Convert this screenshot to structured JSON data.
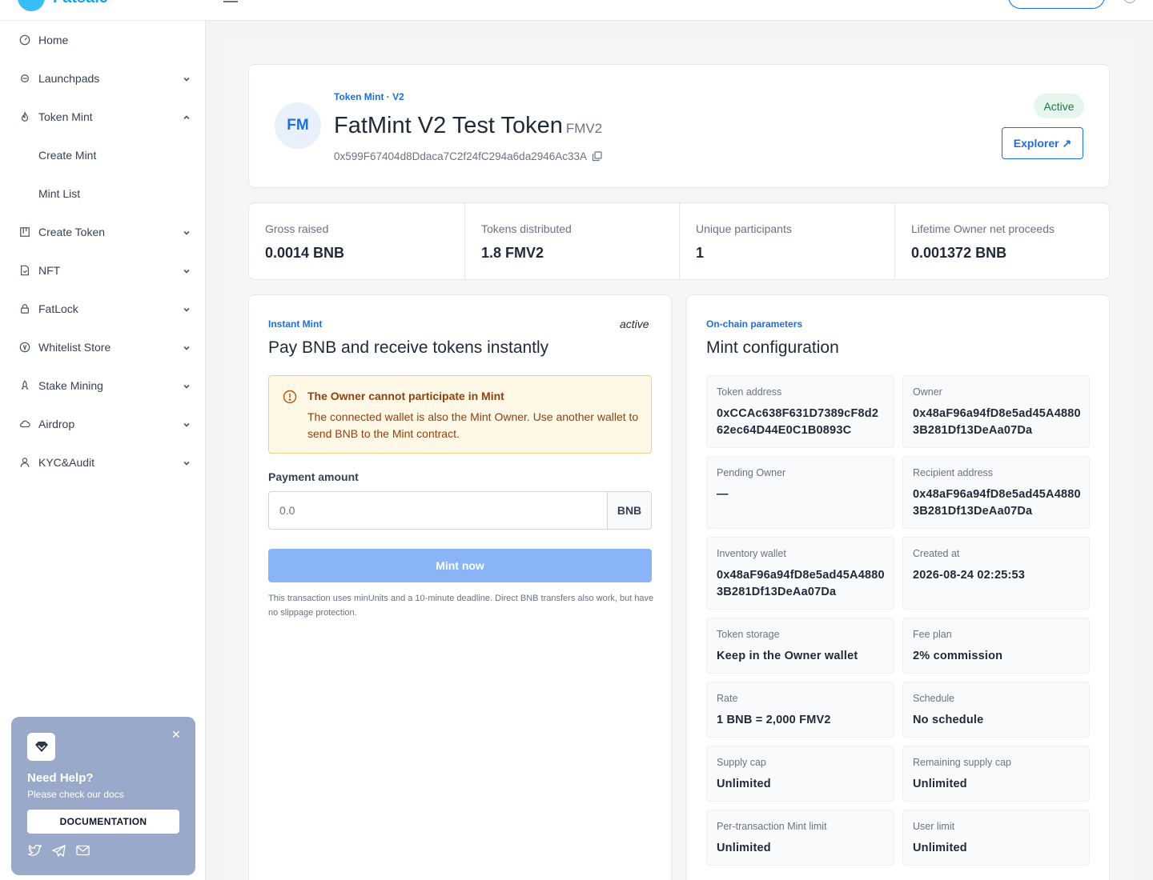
{
  "topbar": {
    "brand": "Fatsale"
  },
  "sidebar": {
    "items": [
      {
        "label": "Home",
        "icon": "gauge-icon",
        "expandable": false
      },
      {
        "label": "Launchpads",
        "icon": "rocket-icon",
        "expandable": true
      },
      {
        "label": "Token Mint",
        "icon": "flame-icon",
        "expandable": true,
        "expanded": true
      },
      {
        "label": "Create Mint",
        "sub": true
      },
      {
        "label": "Mint List",
        "sub": true
      },
      {
        "label": "Create Token",
        "icon": "grid-icon",
        "expandable": true
      },
      {
        "label": "NFT",
        "icon": "file-icon",
        "expandable": true
      },
      {
        "label": "FatLock",
        "icon": "lock-icon",
        "expandable": true
      },
      {
        "label": "Whitelist Store",
        "icon": "coin-icon",
        "expandable": true
      },
      {
        "label": "Stake Mining",
        "icon": "rocket-small-icon",
        "expandable": true
      },
      {
        "label": "Airdrop",
        "icon": "cloud-icon",
        "expandable": true
      },
      {
        "label": "KYC&Audit",
        "icon": "user-icon",
        "expandable": true
      }
    ],
    "help": {
      "title": "Need Help?",
      "subtitle": "Please check our docs",
      "button": "DOCUMENTATION"
    }
  },
  "header": {
    "eyebrow": "Token Mint · V2",
    "avatar": "FM",
    "name": "FatMint V2 Test Token",
    "symbol": "FMV2",
    "address": "0x599F67404d8Ddaca7C2f24fC294a6da2946Ac33A",
    "status": "Active",
    "explorer_label": "Explorer ↗"
  },
  "stats": [
    {
      "label": "Gross raised",
      "value": "0.0014 BNB"
    },
    {
      "label": "Tokens distributed",
      "value": "1.8 FMV2"
    },
    {
      "label": "Unique participants",
      "value": "1"
    },
    {
      "label": "Lifetime Owner net proceeds",
      "value": "0.001372 BNB"
    }
  ],
  "mint": {
    "eyebrow": "Instant Mint",
    "status": "active",
    "title": "Pay BNB and receive tokens instantly",
    "warning_title": "The Owner cannot participate in Mint",
    "warning_text": "The connected wallet is also the Mint Owner. Use another wallet to send BNB to the Mint contract.",
    "payment_label": "Payment amount",
    "payment_placeholder": "0.0",
    "payment_unit": "BNB",
    "button": "Mint now",
    "note": "This transaction uses minUnits and a 10-minute deadline. Direct BNB transfers also work, but have no slippage protection."
  },
  "config": {
    "eyebrow": "On-chain parameters",
    "title": "Mint configuration",
    "params": [
      {
        "label": "Token address",
        "value": "0xCCAc638F631D7389cF8d262ec64D44E0C1B0893C"
      },
      {
        "label": "Owner",
        "value": "0x48aF96a94fD8e5ad45A48803B281Df13DeAa07Da"
      },
      {
        "label": "Pending Owner",
        "value": "—"
      },
      {
        "label": "Recipient address",
        "value": "0x48aF96a94fD8e5ad45A48803B281Df13DeAa07Da"
      },
      {
        "label": "Inventory wallet",
        "value": "0x48aF96a94fD8e5ad45A48803B281Df13DeAa07Da"
      },
      {
        "label": "Created at",
        "value": "2026-08-24 02:25:53"
      },
      {
        "label": "Token storage",
        "value": "Keep in the Owner wallet"
      },
      {
        "label": "Fee plan",
        "value": "2% commission"
      },
      {
        "label": "Rate",
        "value": "1 BNB = 2,000 FMV2"
      },
      {
        "label": "Schedule",
        "value": "No schedule"
      },
      {
        "label": "Supply cap",
        "value": "Unlimited"
      },
      {
        "label": "Remaining supply cap",
        "value": "Unlimited"
      },
      {
        "label": "Per-transaction Mint limit",
        "value": "Unlimited"
      },
      {
        "label": "User limit",
        "value": "Unlimited"
      }
    ]
  },
  "colors": {
    "accent": "#1d6fe0",
    "active_bg": "#e6f6ec",
    "warning_bg": "#fff8e6",
    "mint_button": "#8ab4f8"
  }
}
